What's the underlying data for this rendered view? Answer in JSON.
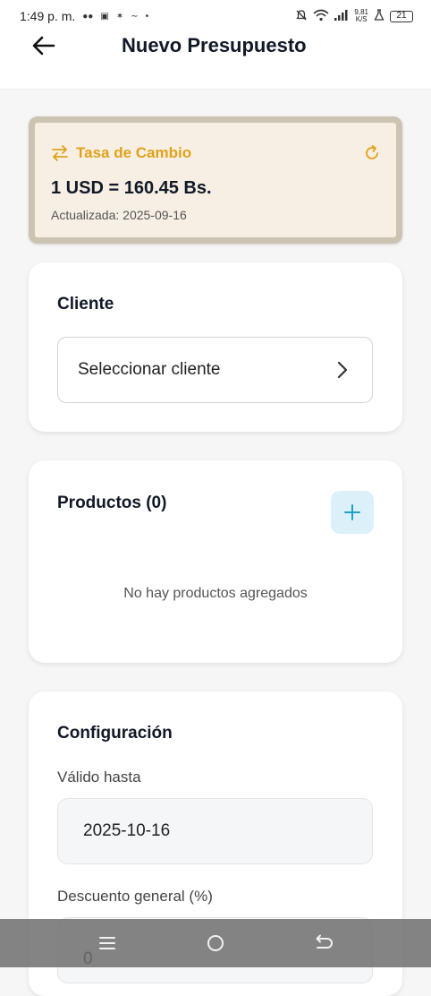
{
  "status_bar": {
    "time": "1:49 p. m.",
    "net_speed_value": "9,81",
    "net_speed_unit": "K/S",
    "battery": "21"
  },
  "header": {
    "title": "Nuevo Presupuesto",
    "back_icon": "arrow-left-icon"
  },
  "exchange_rate": {
    "title": "Tasa de Cambio",
    "rate": "1 USD = 160.45 Bs.",
    "updated": "Actualizada: 2025-09-16",
    "accent_color": "#e0a21a",
    "background_color": "#f7efe3"
  },
  "client": {
    "title": "Cliente",
    "select_label": "Seleccionar cliente"
  },
  "products": {
    "title": "Productos (0)",
    "empty_message": "No hay productos agregados",
    "add_button_color": "#dcf0fa"
  },
  "config": {
    "title": "Configuración",
    "valid_until_label": "Válido hasta",
    "valid_until_value": "2025-10-16",
    "discount_label": "Descuento general (%)",
    "discount_value": "0"
  },
  "nav_bar": {
    "icons": [
      "menu-icon",
      "home-icon",
      "back-icon"
    ]
  }
}
